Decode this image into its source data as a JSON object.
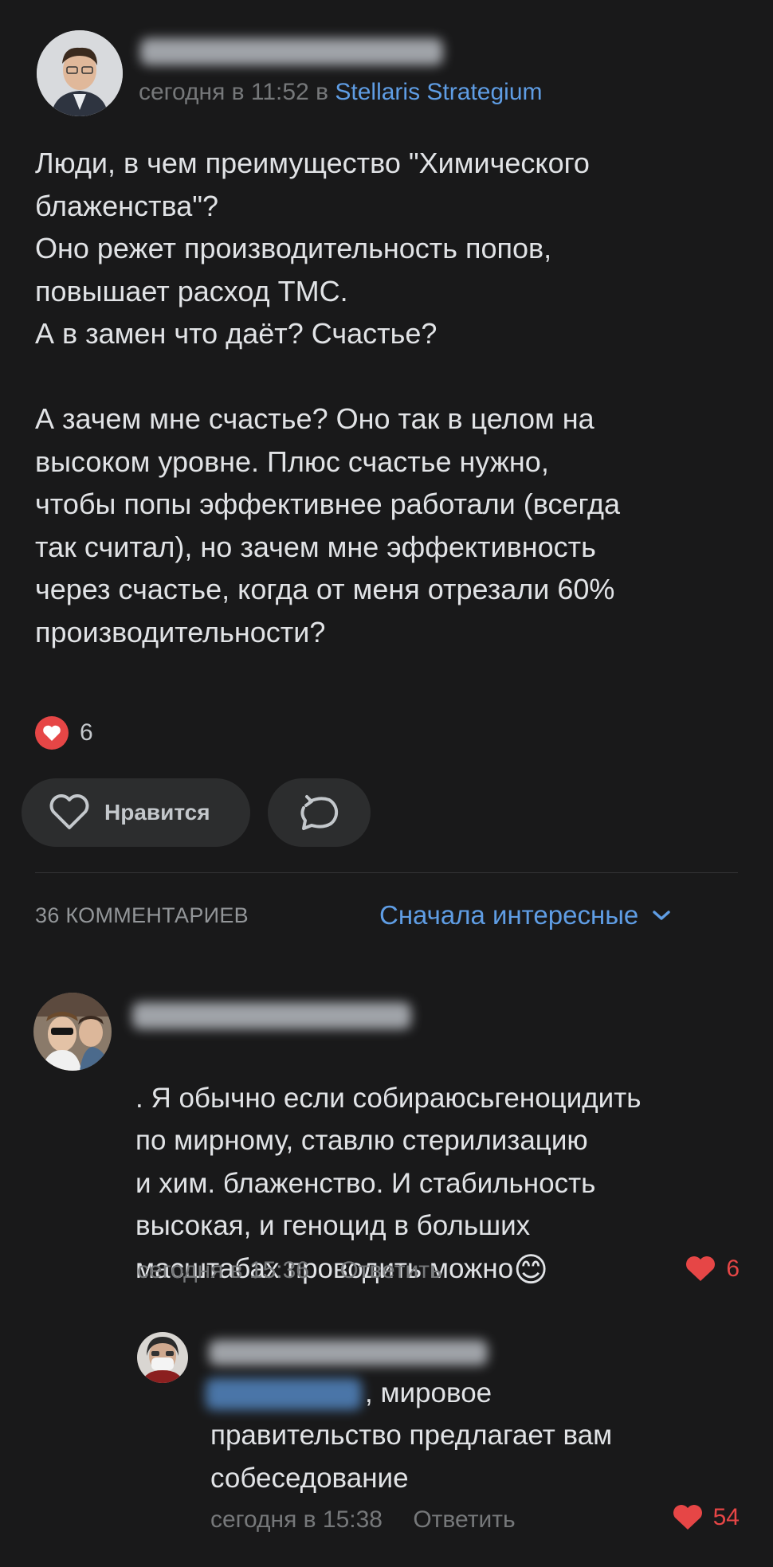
{
  "post": {
    "time": "сегодня в 11:52",
    "in_word": "в",
    "community": "Stellaris Strategium",
    "text": "Люди,  в чем преимущество \"Химического\nблаженства\"?\nОно режет производительность попов,\nповышает расход ТМС.\nА в замен что даёт? Счастье?\n\nА зачем мне счастье? Оно так в целом на\nвысоком уровне. Плюс счастье нужно,\nчтобы попы эффективнее работали (всегда\nтак считал), но зачем мне эффективность\nчерез счастье, когда от меня отрезали 60%\nпроизводительности?",
    "reactions_count": "6",
    "like_button_label": "Нравится"
  },
  "comments_header": {
    "count_label": "36 КОММЕНТАРИЕВ",
    "sort_label": "Сначала интересные"
  },
  "comments": [
    {
      "text": ". Я обычно если собираюсьгеноцидить\nпо мирному, ставлю стерилизацию\nи хим. блаженство. И стабильность\nвысокая, и геноцид в больших\nмасштабах проводить можно",
      "emoji": "😊",
      "time": "сегодня в 15:36",
      "reply_label": "Ответить",
      "likes": "6"
    },
    {
      "text_suffix": ", мировое",
      "text": "правительство предлагает вам\nсобеседование",
      "time": "сегодня в 15:38",
      "reply_label": "Ответить",
      "likes": "54"
    }
  ],
  "colors": {
    "background": "#19191a",
    "link": "#5f9de4",
    "like": "#e64646",
    "muted": "#76787a"
  }
}
